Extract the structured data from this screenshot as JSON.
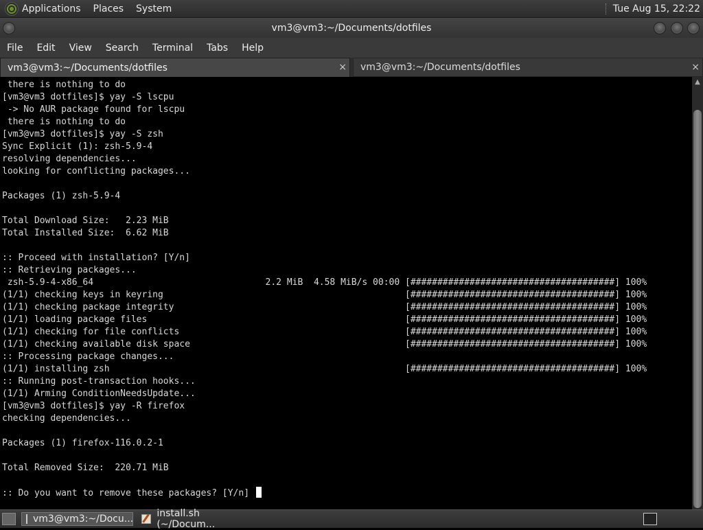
{
  "top_panel": {
    "menus": [
      "Applications",
      "Places",
      "System"
    ],
    "clock": "Tue Aug 15, 22:22"
  },
  "window": {
    "title": "vm3@vm3:~/Documents/dotfiles",
    "menu": [
      "File",
      "Edit",
      "View",
      "Search",
      "Terminal",
      "Tabs",
      "Help"
    ],
    "tabs": [
      {
        "label": "vm3@vm3:~/Documents/dotfiles",
        "active": true
      },
      {
        "label": "vm3@vm3:~/Documents/dotfiles",
        "active": false
      }
    ],
    "tab_close_glyph": "×"
  },
  "terminal": {
    "lines": [
      " there is nothing to do",
      "[vm3@vm3 dotfiles]$ yay -S lscpu",
      " -> No AUR package found for lscpu",
      " there is nothing to do",
      "[vm3@vm3 dotfiles]$ yay -S zsh",
      "Sync Explicit (1): zsh-5.9-4",
      "resolving dependencies...",
      "looking for conflicting packages...",
      "",
      "Packages (1) zsh-5.9-4",
      "",
      "Total Download Size:   2.23 MiB",
      "Total Installed Size:  6.62 MiB",
      "",
      ":: Proceed with installation? [Y/n]",
      ":: Retrieving packages...",
      " zsh-5.9-4-x86_64                                2.2 MiB  4.58 MiB/s 00:00 [######################################] 100%",
      "(1/1) checking keys in keyring                                             [######################################] 100%",
      "(1/1) checking package integrity                                           [######################################] 100%",
      "(1/1) loading package files                                                [######################################] 100%",
      "(1/1) checking for file conflicts                                          [######################################] 100%",
      "(1/1) checking available disk space                                        [######################################] 100%",
      ":: Processing package changes...",
      "(1/1) installing zsh                                                       [######################################] 100%",
      ":: Running post-transaction hooks...",
      "(1/1) Arming ConditionNeedsUpdate...",
      "[vm3@vm3 dotfiles]$ yay -R firefox",
      "checking dependencies...",
      "",
      "Packages (1) firefox-116.0.2-1",
      "",
      "Total Removed Size:  220.71 MiB",
      "",
      ":: Do you want to remove these packages? [Y/n] "
    ]
  },
  "taskbar": {
    "tasks": [
      {
        "label": "vm3@vm3:~/Docu...",
        "icon": "terminal-icon",
        "active": true
      },
      {
        "label": "install.sh (~/Docum...",
        "icon": "text-editor-icon",
        "active": false
      }
    ]
  },
  "icons": {
    "scroll_up": "▲"
  }
}
